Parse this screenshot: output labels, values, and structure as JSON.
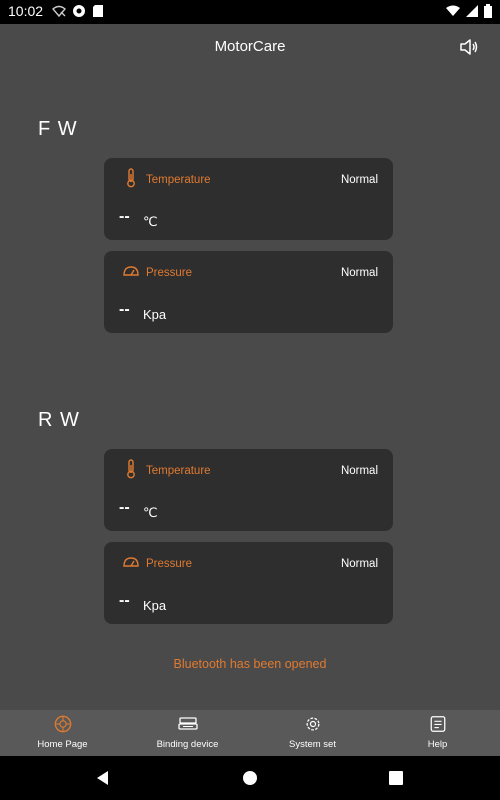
{
  "status_bar": {
    "time": "10:02",
    "icons_left": [
      "wifi-off-icon",
      "app-notification-icon",
      "sd-card-icon"
    ],
    "icons_right": [
      "wifi-icon",
      "signal-icon",
      "battery-icon"
    ]
  },
  "header": {
    "title": "MotorCare",
    "sound_icon": "speaker-icon"
  },
  "front_wheel": {
    "label": "F W",
    "temperature": {
      "label": "Temperature",
      "status": "Normal",
      "value": "--",
      "unit": "℃"
    },
    "pressure": {
      "label": "Pressure",
      "status": "Normal",
      "value": "--",
      "unit": "Kpa"
    }
  },
  "rear_wheel": {
    "label": "R W",
    "temperature": {
      "label": "Temperature",
      "status": "Normal",
      "value": "--",
      "unit": "℃"
    },
    "pressure": {
      "label": "Pressure",
      "status": "Normal",
      "value": "--",
      "unit": "Kpa"
    }
  },
  "message": "Bluetooth has been opened",
  "bottom_nav": {
    "items": [
      {
        "label": "Home Page",
        "icon": "tire-icon",
        "active": true
      },
      {
        "label": "Binding device",
        "icon": "binding-device-icon",
        "active": false
      },
      {
        "label": "System set",
        "icon": "gear-icon",
        "active": false
      },
      {
        "label": "Help",
        "icon": "help-book-icon",
        "active": false
      }
    ]
  },
  "colors": {
    "accent": "#e07a30",
    "background": "#4a4a4a",
    "card": "#2e2e2e",
    "nav": "#595959"
  }
}
